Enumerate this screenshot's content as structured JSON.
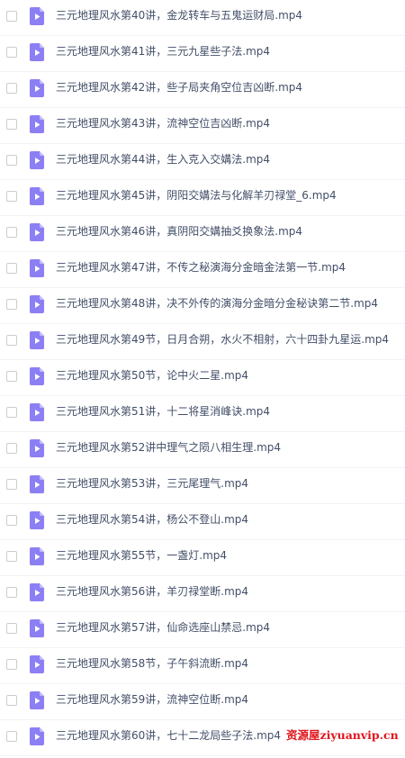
{
  "files": [
    {
      "name": "三元地理风水第40讲，金龙转车与五鬼运财局.mp4"
    },
    {
      "name": "三元地理风水第41讲，三元九星些子法.mp4"
    },
    {
      "name": "三元地理风水第42讲，些子局夹角空位吉凶断.mp4"
    },
    {
      "name": "三元地理风水第43讲，流神空位吉凶断.mp4"
    },
    {
      "name": "三元地理风水第44讲，生入克入交媾法.mp4"
    },
    {
      "name": "三元地理风水第45讲，阴阳交媾法与化解羊刃禄堂_6.mp4"
    },
    {
      "name": "三元地理风水第46讲，真阴阳交媾抽爻换象法.mp4"
    },
    {
      "name": "三元地理风水第47讲，不传之秘演海分金暗金法第一节.mp4"
    },
    {
      "name": "三元地理风水第48讲，决不外传的演海分金暗分金秘诀第二节.mp4"
    },
    {
      "name": "三元地理风水第49节，日月合朔，水火不相射，六十四卦九星运.mp4"
    },
    {
      "name": "三元地理风水第50节，论中火二星.mp4"
    },
    {
      "name": "三元地理风水第51讲，十二将星消峰诀.mp4"
    },
    {
      "name": "三元地理风水第52讲中理气之陨八相生理.mp4"
    },
    {
      "name": "三元地理风水第53讲，三元尾理气.mp4"
    },
    {
      "name": "三元地理风水第54讲，杨公不登山.mp4"
    },
    {
      "name": "三元地理风水第55节，一盏灯.mp4"
    },
    {
      "name": "三元地理风水第56讲，羊刃禄堂断.mp4"
    },
    {
      "name": "三元地理风水第57讲，仙命选座山禁忌.mp4"
    },
    {
      "name": "三元地理风水第58节，子午斜流断.mp4"
    },
    {
      "name": "三元地理风水第59讲，流神空位断.mp4"
    },
    {
      "name": "三元地理风水第60讲，七十二龙局些子法.mp4"
    }
  ],
  "watermark": "资源屋ziyuanvip.cn",
  "colors": {
    "file_icon": "#8c7ff4",
    "text": "#424e67",
    "watermark": "#e0141b"
  },
  "icons": {
    "file": "video-file-icon"
  }
}
